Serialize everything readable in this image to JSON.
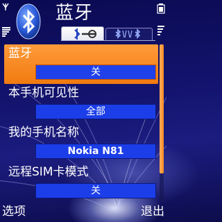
{
  "header": {
    "title": "蓝牙",
    "icon": "bluetooth-icon",
    "tabs": [
      {
        "icon": "settings-icon",
        "active": true
      },
      {
        "icon": "paired-devices-icon",
        "active": false
      }
    ]
  },
  "settings": [
    {
      "label": "蓝牙",
      "value": "关"
    },
    {
      "label": "本手机可见性",
      "value": "全部"
    },
    {
      "label": "我的手机名称",
      "value": "Nokia N81"
    },
    {
      "label": "远程SIM卡模式",
      "value": "关"
    }
  ],
  "softkeys": {
    "left": "选项",
    "right": "退出"
  },
  "colors": {
    "highlight": "#f58a20",
    "value_box": "#1c3ee8",
    "background": "#14146e",
    "bluetooth_logo": "#3a6fe8"
  }
}
